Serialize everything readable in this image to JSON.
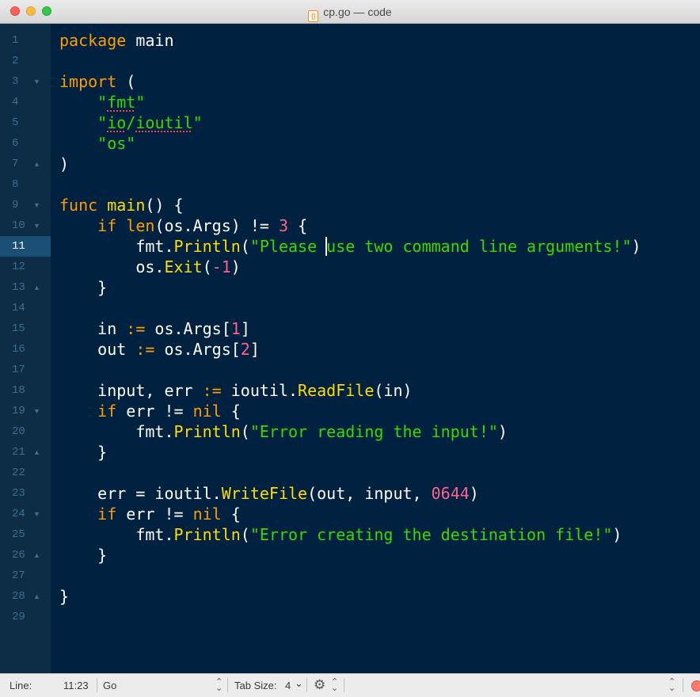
{
  "window": {
    "title": "cp.go — code",
    "file_icon": "{}"
  },
  "editor": {
    "current_line": 11,
    "lines": [
      {
        "n": "1",
        "fold": "",
        "segs": [
          [
            "kw",
            "package"
          ],
          [
            "plain",
            " main"
          ]
        ]
      },
      {
        "n": "2",
        "fold": "",
        "segs": []
      },
      {
        "n": "3",
        "fold": "▼",
        "segs": [
          [
            "kw",
            "import"
          ],
          [
            "plain",
            " ("
          ]
        ]
      },
      {
        "n": "4",
        "fold": "",
        "segs": [
          [
            "plain",
            "    "
          ],
          [
            "str",
            "\""
          ],
          [
            "spell",
            "fmt"
          ],
          [
            "str",
            "\""
          ]
        ]
      },
      {
        "n": "5",
        "fold": "",
        "segs": [
          [
            "plain",
            "    "
          ],
          [
            "str",
            "\""
          ],
          [
            "spell",
            "io"
          ],
          [
            "str",
            "/"
          ],
          [
            "spell",
            "ioutil"
          ],
          [
            "str",
            "\""
          ]
        ]
      },
      {
        "n": "6",
        "fold": "",
        "segs": [
          [
            "plain",
            "    "
          ],
          [
            "str",
            "\"os\""
          ]
        ]
      },
      {
        "n": "7",
        "fold": "▲",
        "segs": [
          [
            "plain",
            ")"
          ]
        ]
      },
      {
        "n": "8",
        "fold": "",
        "segs": []
      },
      {
        "n": "9",
        "fold": "▼",
        "segs": [
          [
            "kw",
            "func"
          ],
          [
            "plain",
            " "
          ],
          [
            "fn",
            "main"
          ],
          [
            "plain",
            "() {"
          ]
        ]
      },
      {
        "n": "10",
        "fold": "▼",
        "segs": [
          [
            "plain",
            "    "
          ],
          [
            "kw",
            "if"
          ],
          [
            "plain",
            " "
          ],
          [
            "kw",
            "len"
          ],
          [
            "plain",
            "(os.Args) != "
          ],
          [
            "num",
            "3"
          ],
          [
            "plain",
            " {"
          ]
        ]
      },
      {
        "n": "11",
        "fold": "",
        "segs": [
          [
            "plain",
            "        fmt."
          ],
          [
            "fn",
            "Println"
          ],
          [
            "plain",
            "("
          ],
          [
            "str",
            "\"Please "
          ],
          [
            "caret",
            ""
          ],
          [
            "str",
            "use two command line arguments!\""
          ],
          [
            "plain",
            ")"
          ]
        ]
      },
      {
        "n": "12",
        "fold": "",
        "segs": [
          [
            "plain",
            "        os."
          ],
          [
            "fn",
            "Exit"
          ],
          [
            "plain",
            "("
          ],
          [
            "num",
            "-1"
          ],
          [
            "plain",
            ")"
          ]
        ]
      },
      {
        "n": "13",
        "fold": "▲",
        "segs": [
          [
            "plain",
            "    }"
          ]
        ]
      },
      {
        "n": "14",
        "fold": "",
        "segs": []
      },
      {
        "n": "15",
        "fold": "",
        "segs": [
          [
            "plain",
            "    in "
          ],
          [
            "kw",
            ":="
          ],
          [
            "plain",
            " os.Args["
          ],
          [
            "num",
            "1"
          ],
          [
            "plain",
            "]"
          ]
        ]
      },
      {
        "n": "16",
        "fold": "",
        "segs": [
          [
            "plain",
            "    out "
          ],
          [
            "kw",
            ":="
          ],
          [
            "plain",
            " os.Args["
          ],
          [
            "num",
            "2"
          ],
          [
            "plain",
            "]"
          ]
        ]
      },
      {
        "n": "17",
        "fold": "",
        "segs": []
      },
      {
        "n": "18",
        "fold": "",
        "segs": [
          [
            "plain",
            "    input, err "
          ],
          [
            "kw",
            ":="
          ],
          [
            "plain",
            " ioutil."
          ],
          [
            "fn",
            "ReadFile"
          ],
          [
            "plain",
            "(in)"
          ]
        ]
      },
      {
        "n": "19",
        "fold": "▼",
        "segs": [
          [
            "plain",
            "    "
          ],
          [
            "kw",
            "if"
          ],
          [
            "plain",
            " err != "
          ],
          [
            "kw",
            "nil"
          ],
          [
            "plain",
            " {"
          ]
        ]
      },
      {
        "n": "20",
        "fold": "",
        "segs": [
          [
            "plain",
            "        fmt."
          ],
          [
            "fn",
            "Println"
          ],
          [
            "plain",
            "("
          ],
          [
            "str",
            "\"Error reading the input!\""
          ],
          [
            "plain",
            ")"
          ]
        ]
      },
      {
        "n": "21",
        "fold": "▲",
        "segs": [
          [
            "plain",
            "    }"
          ]
        ]
      },
      {
        "n": "22",
        "fold": "",
        "segs": []
      },
      {
        "n": "23",
        "fold": "",
        "segs": [
          [
            "plain",
            "    err = ioutil."
          ],
          [
            "fn",
            "WriteFile"
          ],
          [
            "plain",
            "(out, input, "
          ],
          [
            "num",
            "0644"
          ],
          [
            "plain",
            ")"
          ]
        ]
      },
      {
        "n": "24",
        "fold": "▼",
        "segs": [
          [
            "plain",
            "    "
          ],
          [
            "kw",
            "if"
          ],
          [
            "plain",
            " err != "
          ],
          [
            "kw",
            "nil"
          ],
          [
            "plain",
            " {"
          ]
        ]
      },
      {
        "n": "25",
        "fold": "",
        "segs": [
          [
            "plain",
            "        fmt."
          ],
          [
            "fn",
            "Println"
          ],
          [
            "plain",
            "("
          ],
          [
            "str",
            "\"Error creating the destination file!\""
          ],
          [
            "plain",
            ")"
          ]
        ]
      },
      {
        "n": "26",
        "fold": "▲",
        "segs": [
          [
            "plain",
            "    }"
          ]
        ]
      },
      {
        "n": "27",
        "fold": "",
        "segs": []
      },
      {
        "n": "28",
        "fold": "▲",
        "segs": [
          [
            "plain",
            "}"
          ]
        ]
      },
      {
        "n": "29",
        "fold": "",
        "segs": []
      }
    ]
  },
  "statusbar": {
    "line_label": "Line:",
    "position": "11:23",
    "language": "Go",
    "tab_size_label": "Tab Size:",
    "tab_size": "4",
    "tab_chevron": "⌄",
    "updown": "⌃⌄",
    "gear": "⚙"
  },
  "colors": {
    "background": "#002240",
    "keyword": "#ff9d00",
    "string": "#3ad900",
    "number": "#ff628c",
    "function": "#ffdd00",
    "gutter": "#0d2c46",
    "current_line_number": "#1c4f74"
  }
}
